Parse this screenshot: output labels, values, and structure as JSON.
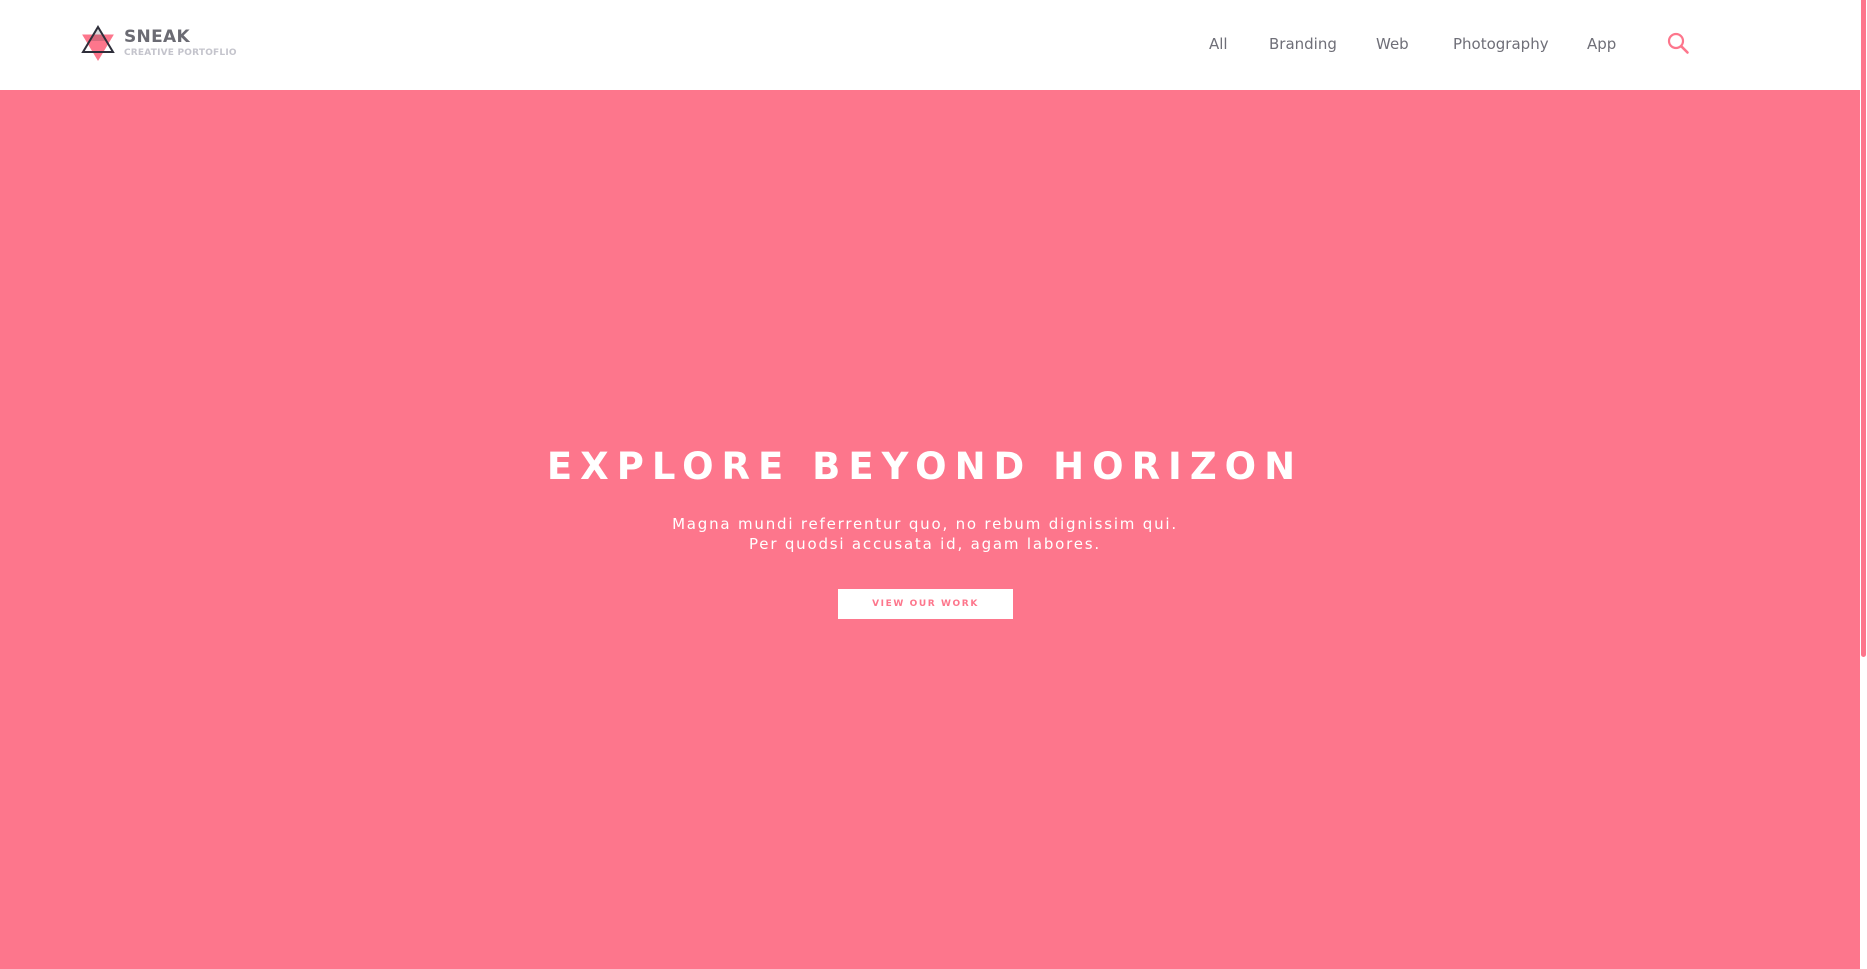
{
  "brand": {
    "name": "SNEAK",
    "tagline": "CREATIVE PORTOFLIO"
  },
  "nav": {
    "items": [
      {
        "label": "All"
      },
      {
        "label": "Branding"
      },
      {
        "label": "Web"
      },
      {
        "label": "Photography"
      },
      {
        "label": "App"
      }
    ],
    "search_icon": "search-icon"
  },
  "hero": {
    "title": "EXPLORE BEYOND HORIZON",
    "line1": "Magna mundi referrentur quo, no rebum dignissim qui.",
    "line2": "Per quodsi accusata id, agam labores.",
    "cta_label": "VIEW OUR WORK"
  },
  "colors": {
    "accent": "#fd768c",
    "nav_text": "#6f6f78",
    "logo_title": "#6b6b73",
    "logo_sub": "#c4c4cc",
    "logo_dark": "#2e2e3a"
  }
}
